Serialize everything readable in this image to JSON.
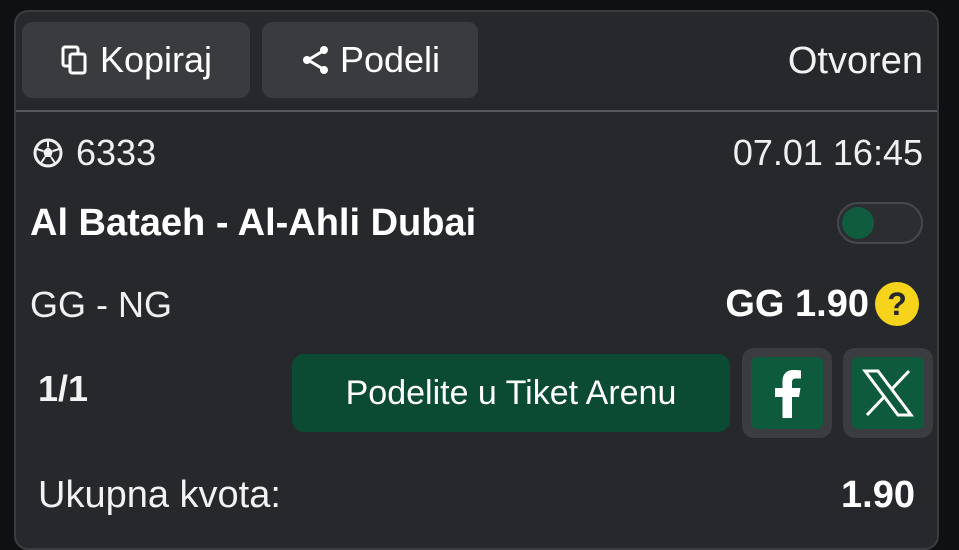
{
  "header": {
    "copy_label": "Kopiraj",
    "share_label": "Podeli",
    "status": "Otvoren"
  },
  "event": {
    "id": "6333",
    "datetime": "07.01 16:45",
    "match": "Al Bataeh - Al-Ahli Dubai",
    "toggle_on": false
  },
  "bet": {
    "market": "GG - NG",
    "pick": "GG 1.90",
    "help": "?"
  },
  "actions": {
    "count": "1/1",
    "arena_label": "Podelite u Tiket Arenu"
  },
  "totals": {
    "label": "Ukupna kvota:",
    "value": "1.90"
  },
  "colors": {
    "card_bg": "#26282b",
    "button_bg": "#393b3f",
    "accent_green": "#0b4a33",
    "help_yellow": "#f5d41b"
  },
  "icons": {
    "copy": "copy-icon",
    "share": "share-icon",
    "sport": "soccer-ball-icon",
    "facebook": "facebook-icon",
    "x": "x-icon"
  }
}
